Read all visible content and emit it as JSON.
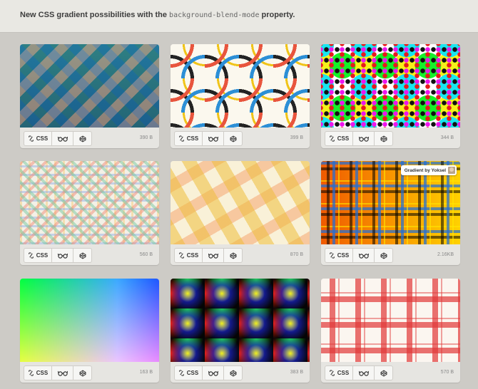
{
  "header": {
    "text_before": "New CSS gradient possibilities with the ",
    "code": "background-blend-mode",
    "text_after": " property."
  },
  "buttons": {
    "css_label": "CSS"
  },
  "icons": {
    "css": "css-icon",
    "view": "glasses-icon",
    "pen": "codepen-icon"
  },
  "cards": [
    {
      "size": "390 B"
    },
    {
      "size": "399 B"
    },
    {
      "size": "344 B"
    },
    {
      "size": "560 B"
    },
    {
      "size": "870 B"
    },
    {
      "size": "2.16KB",
      "badge": "Gradient by Yoksel"
    },
    {
      "size": "163 B"
    },
    {
      "size": "383 B"
    },
    {
      "size": "570 B"
    }
  ]
}
